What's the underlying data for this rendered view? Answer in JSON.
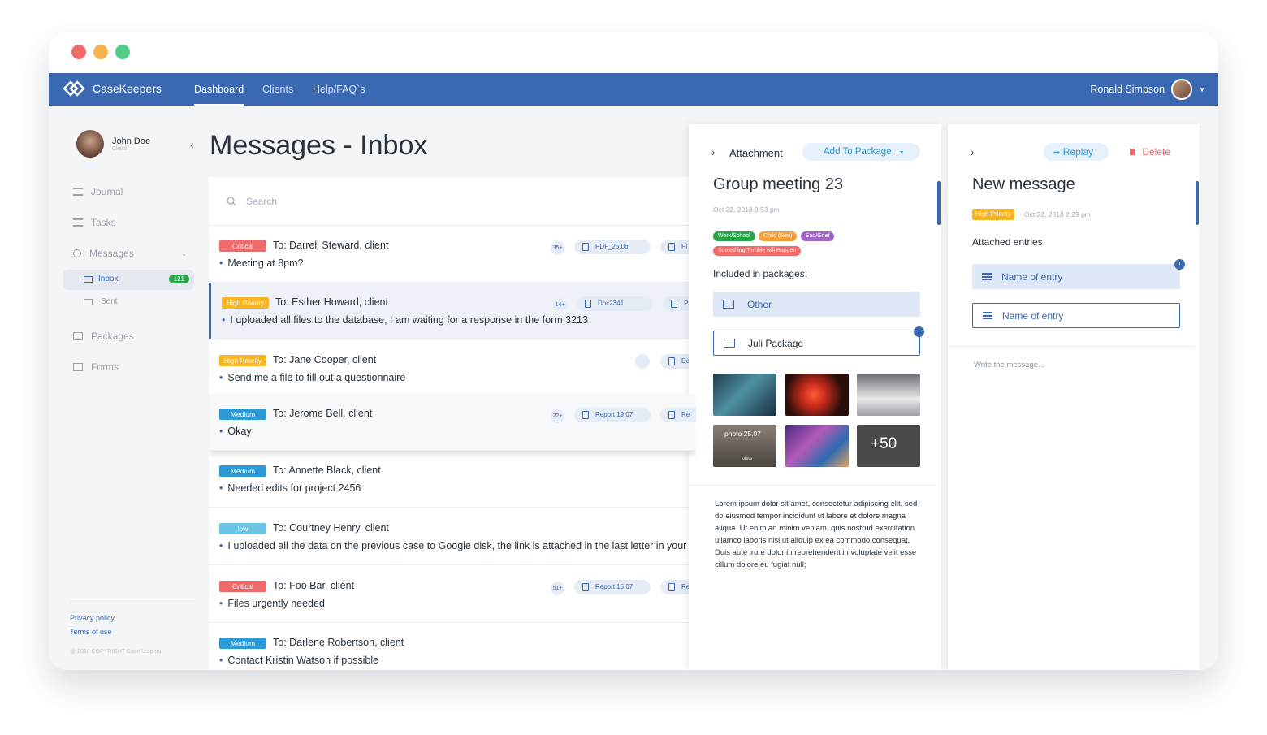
{
  "window": {
    "dots": [
      "#f06a6a",
      "#f6b24b",
      "#4fcc85"
    ]
  },
  "nav": {
    "brand": "CaseKeepers",
    "links": [
      "Dashboard",
      "Clients",
      "Help/FAQ`s"
    ],
    "user": "Ronald Simpson"
  },
  "sidebar": {
    "profile_name": "John Doe",
    "profile_role": "Client",
    "items": [
      "Journal",
      "Tasks",
      "Messages",
      "Inbox",
      "Sent",
      "Packages",
      "Forms"
    ],
    "inbox_count": "121",
    "footer": [
      "Privacy policy",
      "Terms of use",
      "@ 2018 COPYRIGHT CaseKeepers"
    ]
  },
  "page": {
    "title": "Messages - Inbox"
  },
  "search": {
    "placeholder": "Search"
  },
  "messages": [
    {
      "priority": "Critical",
      "to": "To: Darrell Steward, client",
      "text": "Meeting at 8pm?",
      "count": "35+",
      "file": "PDF_25.06",
      "file2": "Pl"
    },
    {
      "priority": "High Priority",
      "to": "To: Esther Howard, client",
      "text": "I uploaded all files to the database, I am waiting for a response in the form 3213",
      "count": "14+",
      "file": "Doc2341",
      "file2": "Pl"
    },
    {
      "priority": "High Priority",
      "to": "To: Jane Cooper, client",
      "text": "Send me a file to fill out a questionnaire",
      "count": "",
      "file": "",
      "file2": "Do"
    },
    {
      "priority": "Medium",
      "to": "To: Jerome Bell, client",
      "text": "Okay",
      "count": "22+",
      "file": "Report 19.07",
      "file2": "Re"
    },
    {
      "priority": "Medium",
      "to": "To: Annette Black, client",
      "text": "Needed edits for project 2456",
      "count": "",
      "file": "",
      "file2": ""
    },
    {
      "priority": "low",
      "to": "To: Courtney Henry, client",
      "text": "I uploaded all the data on the previous case to Google disk, the link is attached in the last letter in your mai",
      "count": "",
      "file": "",
      "file2": ""
    },
    {
      "priority": "Critical",
      "to": "To: Foo Bar, client",
      "text": "Files urgently needed",
      "count": "51+",
      "file": "Report 15.07",
      "file2": "Re"
    },
    {
      "priority": "Medium",
      "to": "To: Darlene Robertson, client",
      "text": "Contact Kristin Watson if possible",
      "count": "",
      "file": "",
      "file2": ""
    }
  ],
  "priority_colors": {
    "Critical": "#f06a6a",
    "High Priority": "#f6b521",
    "Medium": "#2b9ad6",
    "low": "#6cc4e4"
  },
  "attachment": {
    "header": "Attachment",
    "add_btn": "Add To Package",
    "title": "Group meeting 23",
    "date": "Oct 22, 2018 3:53 pm",
    "tags": [
      {
        "label": "Work/School",
        "color": "#2aa44a"
      },
      {
        "label": "Child (Ren)",
        "color": "#f0a03a"
      },
      {
        "label": "Sad/Grief",
        "color": "#a066c6"
      },
      {
        "label": "Something Terrible will Happen",
        "color": "#f06a6a"
      }
    ],
    "included_label": "Included in packages:",
    "packages": [
      "Other",
      "Juli Package"
    ],
    "photo_label": "photo 25.07",
    "photo_view": "view",
    "more": "+50",
    "lorem": "Lorem ipsum dolor sit amet, consectetur adipiscing elit, sed do eiusmod tempor incididunt ut labore et dolore magna aliqua. Ut enim ad minim veniam, quis nostrud exercitation ullamco laboris nisi ut aliquip ex ea commodo consequat. Duis aute irure dolor in reprehenderit in voluptate velit esse cillum dolore eu fugiat null;"
  },
  "newmsg": {
    "replay": "Replay",
    "delete": "Delete",
    "title": "New message",
    "priority": "High Priority",
    "date": "Oct 22, 2018 2:29 pm",
    "attached_label": "Attached entries:",
    "entries": [
      "Name of entry",
      "Name of entry"
    ],
    "placeholder": "Write the message..."
  }
}
